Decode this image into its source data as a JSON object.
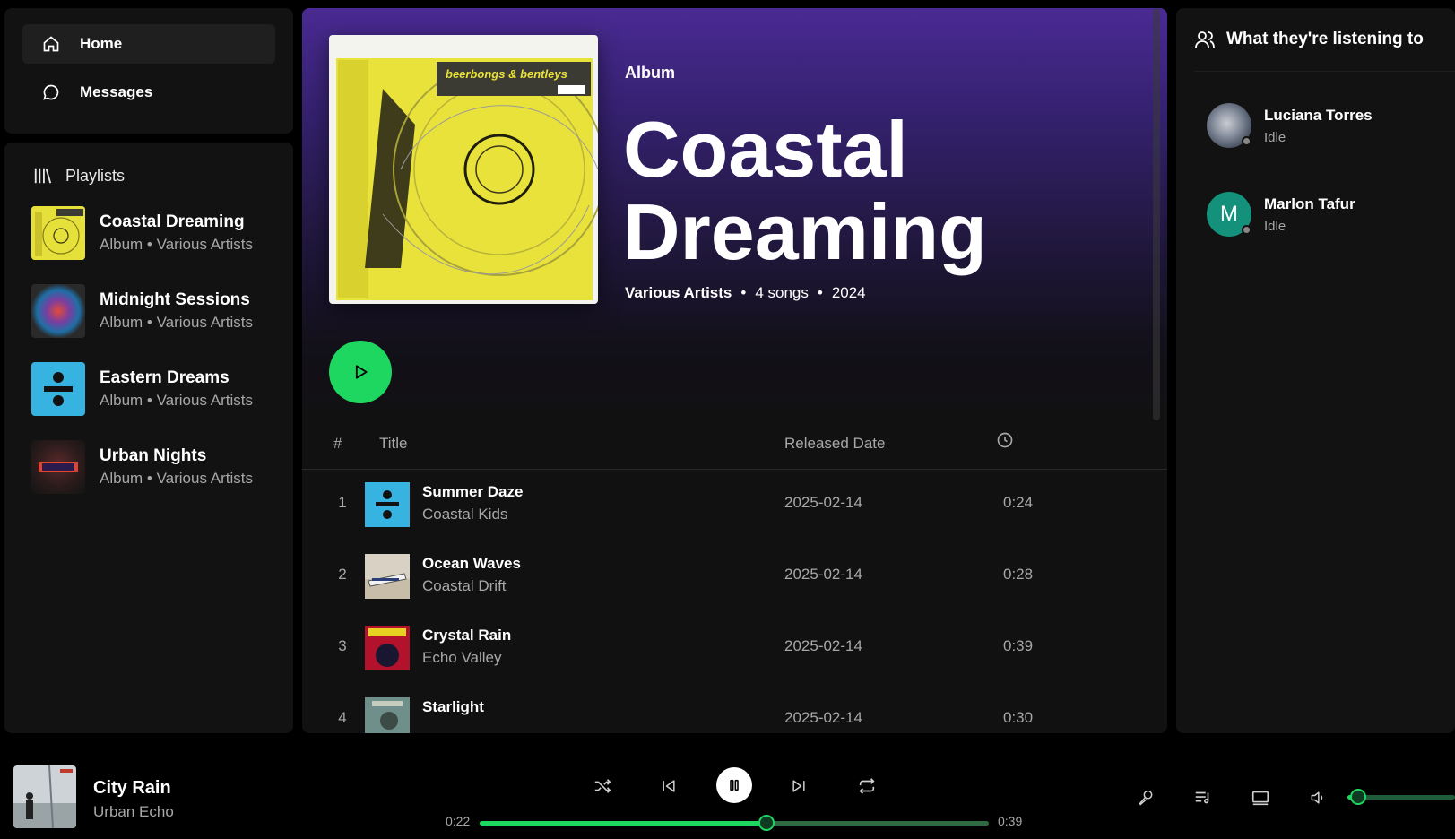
{
  "nav": {
    "home_label": "Home",
    "messages_label": "Messages"
  },
  "library": {
    "title": "Playlists",
    "items": [
      {
        "title": "Coastal Dreaming",
        "subtitle": "Album • Various Artists",
        "cover": "yellow-album-art"
      },
      {
        "title": "Midnight Sessions",
        "subtitle": "Album • Various Artists",
        "cover": "colorful-sphere-art"
      },
      {
        "title": "Eastern Dreams",
        "subtitle": "Album • Various Artists",
        "cover": "blue-divide-art"
      },
      {
        "title": "Urban Nights",
        "subtitle": "Album • Various Artists",
        "cover": "dark-enemy-art"
      }
    ]
  },
  "album": {
    "kicker": "Album",
    "title": "Coastal Dreaming",
    "cover_text": "beerbongs & bentleys",
    "artist": "Various Artists",
    "songs": "4 songs",
    "year": "2024"
  },
  "table": {
    "col_num": "#",
    "col_title": "Title",
    "col_date": "Released Date",
    "col_duration_icon": "clock-icon",
    "rows": [
      {
        "num": "1",
        "title": "Summer Daze",
        "artist": "Coastal Kids",
        "date": "2025-02-14",
        "duration": "0:24"
      },
      {
        "num": "2",
        "title": "Ocean Waves",
        "artist": "Coastal Drift",
        "date": "2025-02-14",
        "duration": "0:28"
      },
      {
        "num": "3",
        "title": "Crystal Rain",
        "artist": "Echo Valley",
        "date": "2025-02-14",
        "duration": "0:39"
      },
      {
        "num": "4",
        "title": "Starlight",
        "artist": "",
        "date": "2025-02-14",
        "duration": "0:30"
      }
    ]
  },
  "friends": {
    "title": "What they're listening to",
    "items": [
      {
        "name": "Luciana Torres",
        "status": "Idle",
        "initial": ""
      },
      {
        "name": "Marlon Tafur",
        "status": "Idle",
        "initial": "M"
      }
    ]
  },
  "player": {
    "title": "City Rain",
    "artist": "Urban Echo",
    "elapsed": "0:22",
    "total": "0:39",
    "progress": 0.564,
    "volume": 0.1
  },
  "colors": {
    "accent": "#1ed760",
    "header_purple": "#4a2a93",
    "background": "#121212"
  }
}
